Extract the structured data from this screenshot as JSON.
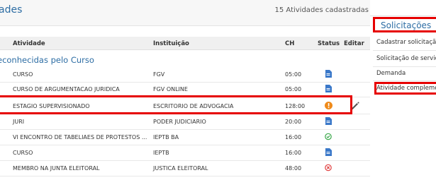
{
  "panel": {
    "title": "ades",
    "count": "15 Atividades cadastradas",
    "columns": [
      "Atividade",
      "Instituição",
      "CH",
      "Status",
      "Editar"
    ],
    "group": "econhecidas pelo Curso",
    "rows": [
      {
        "atividade": "CURSO",
        "instituicao": "FGV",
        "ch": "05:00",
        "status": "doc",
        "editable": false
      },
      {
        "atividade": "CURSO DE ARGUMENTACAO JURIDICA",
        "instituicao": "FGV ONLINE",
        "ch": "05:00",
        "status": "doc",
        "editable": false
      },
      {
        "atividade": "ESTAGIO SUPERVISIONADO",
        "instituicao": "ESCRITORIO DE ADVOGACIA",
        "ch": "128:00",
        "status": "alert",
        "editable": true
      },
      {
        "atividade": "JURI",
        "instituicao": "PODER JUDICIARIO",
        "ch": "20:00",
        "status": "doc",
        "editable": false
      },
      {
        "atividade": "VI ENCONTRO DE TABELIAES DE PROTESTOS ...",
        "instituicao": "IEPTB BA",
        "ch": "16:00",
        "status": "approved",
        "editable": false
      },
      {
        "atividade": "CURSO",
        "instituicao": "IEPTB",
        "ch": "16:00",
        "status": "doc",
        "editable": false
      },
      {
        "atividade": "MEMBRO NA JUNTA ELEITORAL",
        "instituicao": "JUSTICA ELEITORAL",
        "ch": "48:00",
        "status": "rejected",
        "editable": false
      }
    ]
  },
  "sidebar": {
    "title": "Solicitações",
    "items": [
      "Cadastrar solicitação",
      "Solicitação de serviço",
      "Demanda",
      "Atividade complementar"
    ]
  },
  "colors": {
    "accent": "#2d6da4",
    "highlight": "#e60000",
    "doc": "#3a78c9",
    "alert": "#ef8a1a",
    "approved": "#3aa84a",
    "rejected": "#e04040"
  },
  "icons": {
    "doc": "document-icon",
    "alert": "alert-icon",
    "approved": "check-circle-icon",
    "rejected": "x-circle-icon",
    "edit": "pencil-icon"
  }
}
